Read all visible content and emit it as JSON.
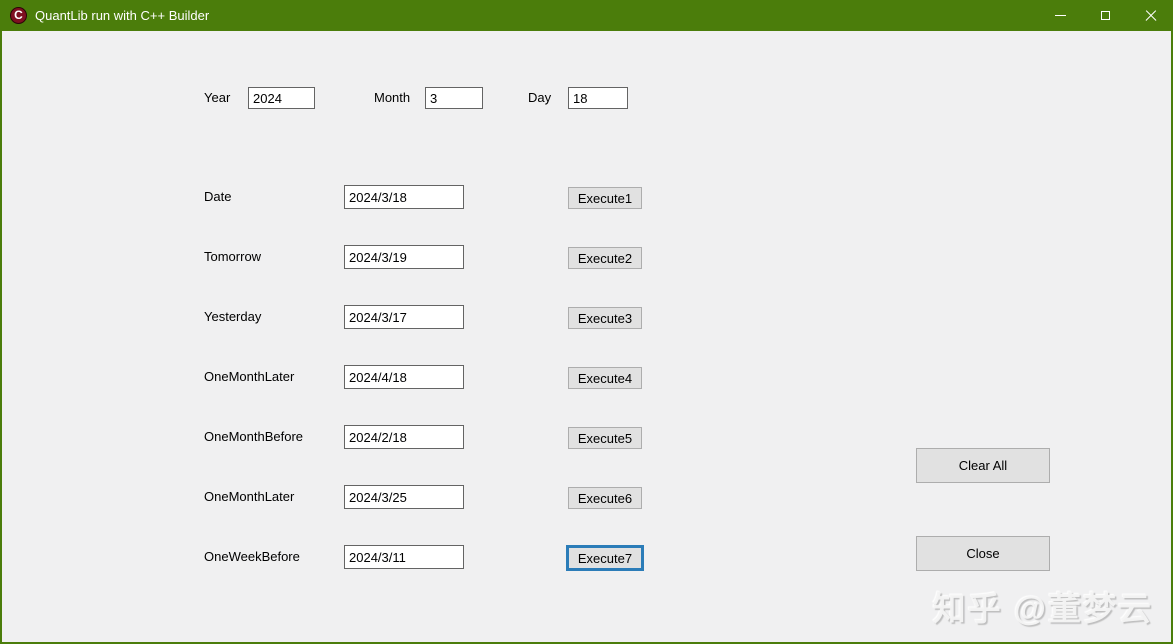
{
  "window": {
    "title": "QuantLib run with C++ Builder",
    "app_icon": "C",
    "controls": [
      "minimize",
      "maximize",
      "close"
    ]
  },
  "colors": {
    "titlebar_green": "#4B7D0B",
    "client_bg": "#F0F0F1",
    "button_bg": "#E1E1E1",
    "button_border": "#ADADAD",
    "focused_button_border": "#2B7CB8",
    "app_icon_red": "#7E1020"
  },
  "top_row": {
    "fields": [
      {
        "label": "Year",
        "value": "2024"
      },
      {
        "label": "Month",
        "value": "3"
      },
      {
        "label": "Day",
        "value": "18"
      }
    ]
  },
  "form": {
    "rows": [
      {
        "label": "Date",
        "value": "2024/3/18",
        "button": "Execute1"
      },
      {
        "label": "Tomorrow",
        "value": "2024/3/19",
        "button": "Execute2"
      },
      {
        "label": "Yesterday",
        "value": "2024/3/17",
        "button": "Execute3"
      },
      {
        "label": "OneMonthLater",
        "value": "2024/4/18",
        "button": "Execute4"
      },
      {
        "label": "OneMonthBefore",
        "value": "2024/2/18",
        "button": "Execute5"
      },
      {
        "label": "OneMonthLater",
        "value": "2024/3/25",
        "button": "Execute6"
      },
      {
        "label": "OneWeekBefore",
        "value": "2024/3/11",
        "button": "Execute7"
      }
    ]
  },
  "actions": {
    "clear_all": "Clear All",
    "close": "Close"
  },
  "watermark": "知乎 @董梦云"
}
